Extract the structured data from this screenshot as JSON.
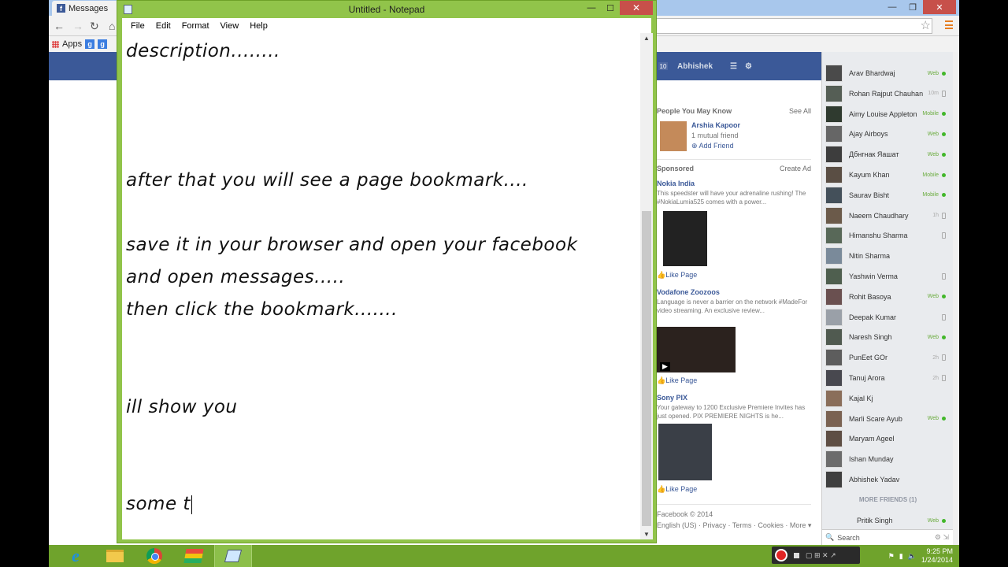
{
  "browser": {
    "tab_title": "Messages",
    "bookmark_apps": "Apps",
    "window_controls": {
      "minimize": "—",
      "maximize": "❐",
      "close": "✕"
    }
  },
  "notepad": {
    "title": "Untitled - Notepad",
    "menu": [
      "File",
      "Edit",
      "Format",
      "View",
      "Help"
    ],
    "lines": [
      "description........",
      "after that you will see a page bookmark....",
      "save it in your browser and open your facebook",
      "and open messages.....",
      "then click the bookmark.......",
      "ill show you",
      "some t"
    ]
  },
  "facebook": {
    "user_name": "Abhishek",
    "badge_count": "10",
    "people_you_may_know": {
      "heading": "People You May Know",
      "see_all": "See All",
      "name": "Arshia Kapoor",
      "mutual": "1 mutual friend",
      "add_friend": "Add Friend"
    },
    "sponsored": {
      "heading": "Sponsored",
      "create_ad": "Create Ad",
      "ads": [
        {
          "name": "Nokia India",
          "text": "This speedster will have your adrenaline rushing! The #NokiaLumia525 comes with a power...",
          "like": "Like Page"
        },
        {
          "name": "Vodafone Zoozoos",
          "text": "Language is never a barrier on the network #MadeFor video streaming. An exclusive review...",
          "like": "Like Page"
        },
        {
          "name": "Sony PIX",
          "text": "Your gateway to 1200 Exclusive Premiere Invites has just opened. PIX PREMIERE NIGHTS is he...",
          "like": "Like Page"
        }
      ]
    },
    "footer": {
      "copyright": "Facebook © 2014",
      "links": "English (US) · Privacy · Terms · Cookies · More ▾"
    }
  },
  "chat": {
    "friends": [
      {
        "name": "Arav Bhardwaj",
        "status": "Web",
        "indicator": "dot"
      },
      {
        "name": "Rohan Rajput Chauhan",
        "status": "10m",
        "indicator": "phone"
      },
      {
        "name": "Aimy Louise Appleton",
        "status": "Mobile",
        "indicator": "dot"
      },
      {
        "name": "Ajay Airboys",
        "status": "Web",
        "indicator": "dot"
      },
      {
        "name": "Дбнгнак Яашат",
        "status": "Web",
        "indicator": "dot"
      },
      {
        "name": "Kayum Khan",
        "status": "Mobile",
        "indicator": "dot"
      },
      {
        "name": "Saurav Bisht",
        "status": "Mobile",
        "indicator": "dot"
      },
      {
        "name": "Naeem Chaudhary",
        "status": "1h",
        "indicator": "phone"
      },
      {
        "name": "Himanshu Sharma",
        "status": "",
        "indicator": "phone"
      },
      {
        "name": "Nitin Sharma",
        "status": "",
        "indicator": "none"
      },
      {
        "name": "Yashwin Verma",
        "status": "",
        "indicator": "phone"
      },
      {
        "name": "Rohit Basoya",
        "status": "Web",
        "indicator": "dot"
      },
      {
        "name": "Deepak Kumar",
        "status": "",
        "indicator": "phone"
      },
      {
        "name": "Naresh Singh",
        "status": "Web",
        "indicator": "dot"
      },
      {
        "name": "PunEet GOr",
        "status": "2h",
        "indicator": "phone"
      },
      {
        "name": "Tanuj Arora",
        "status": "2h",
        "indicator": "phone"
      },
      {
        "name": "Kajal Kj",
        "status": "",
        "indicator": "none"
      },
      {
        "name": "Marli Scare Ayub",
        "status": "Web",
        "indicator": "dot"
      },
      {
        "name": "Maryam Ageel",
        "status": "",
        "indicator": "none"
      },
      {
        "name": "Ishan Munday",
        "status": "",
        "indicator": "none"
      },
      {
        "name": "Abhishek Yadav",
        "status": "",
        "indicator": "none"
      }
    ],
    "more_friends": "MORE FRIENDS (1)",
    "extra_friend": {
      "name": "Pritik Singh",
      "status": "Web"
    },
    "search_placeholder": "Search"
  },
  "taskbar": {
    "time": "9:25 PM",
    "date": "1/24/2014"
  }
}
